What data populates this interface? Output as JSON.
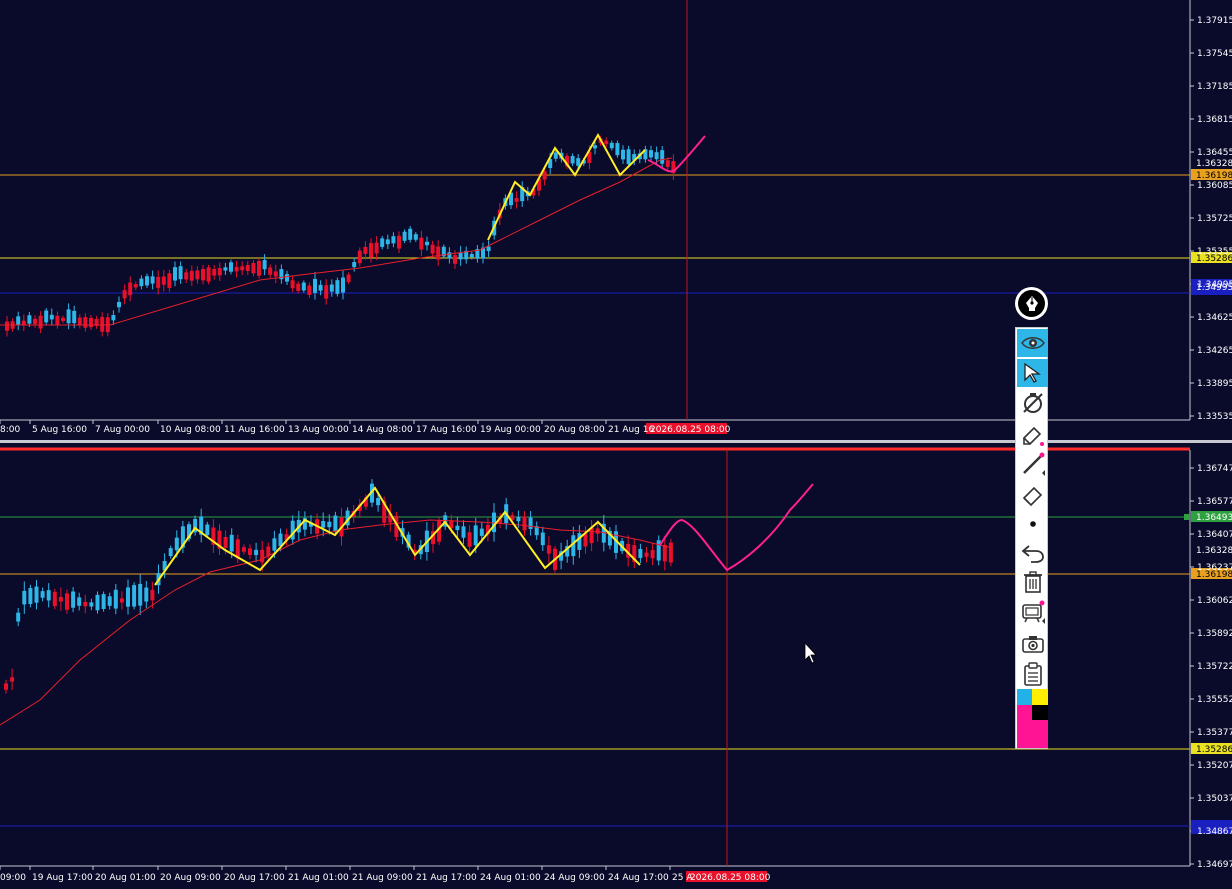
{
  "charts": {
    "top": {
      "price_labels": [
        "1.37915",
        "1.37545",
        "1.37185",
        "1.36815",
        "1.36455",
        "1.36085",
        "1.35725",
        "1.35355",
        "1.34995",
        "1.34625",
        "1.34265",
        "1.33895",
        "1.33535"
      ],
      "time_labels": [
        "8:00",
        "5 Aug 16:00",
        "7 Aug 00:00",
        "10 Aug 08:00",
        "11 Aug 16:00",
        "13 Aug 00:00",
        "14 Aug 08:00",
        "17 Aug 16:00",
        "19 Aug 00:00",
        "20 Aug 08:00",
        "21 Aug 16"
      ],
      "markers": {
        "current_price": "1.36328",
        "orange_level": "1.36198",
        "yellow_level": "1.35286",
        "blue_level": "1.34995",
        "crosshair_time": "2026.08.25 08:00"
      }
    },
    "bottom": {
      "price_labels": [
        "1.36747",
        "1.36577",
        "1.36407",
        "1.36237",
        "1.36062",
        "1.35892",
        "1.35722",
        "1.35552",
        "1.35377",
        "1.35207",
        "1.35037",
        "1.34867",
        "1.34697"
      ],
      "time_labels": [
        "09:00",
        "19 Aug 17:00",
        "20 Aug 01:00",
        "20 Aug 09:00",
        "20 Aug 17:00",
        "21 Aug 01:00",
        "21 Aug 09:00",
        "21 Aug 17:00",
        "24 Aug 01:00",
        "24 Aug 09:00",
        "24 Aug 17:00",
        "25 A"
      ],
      "markers": {
        "green_level": "1.36493",
        "current_price": "1.36328",
        "orange_level": "1.36198",
        "yellow_level": "1.35286",
        "crosshair_time": "2026.08.25 08:00"
      }
    },
    "colors": {
      "background": "#0a0a2a",
      "bull_candle": "#2fb6e8",
      "bear_candle": "#e8102a",
      "moving_average": "#e8202a",
      "zigzag": "#ffee22",
      "projection": "#ff2090",
      "orange_line": "#e8a020",
      "yellow_line": "#e8e020",
      "blue_line": "#1a20c0",
      "green_line": "#2fa040"
    }
  },
  "toolbar": {
    "tools": [
      {
        "name": "eye-icon",
        "active": true
      },
      {
        "name": "cursor-arrow-icon",
        "active": true
      },
      {
        "name": "hide-drawings-icon",
        "active": false
      },
      {
        "name": "marker-tool-icon",
        "active": false
      },
      {
        "name": "line-tool-icon",
        "active": false
      },
      {
        "name": "eraser-icon",
        "active": false
      },
      {
        "name": "dot-size-icon",
        "active": false
      },
      {
        "name": "undo-icon",
        "active": false
      },
      {
        "name": "trash-icon",
        "active": false
      },
      {
        "name": "presets-icon",
        "active": false
      },
      {
        "name": "camera-icon",
        "active": false
      },
      {
        "name": "clipboard-icon",
        "active": false
      }
    ],
    "palette": [
      "#22b2e8",
      "#ffee00",
      "#ff1493",
      "#000000",
      "#ff1493"
    ]
  }
}
